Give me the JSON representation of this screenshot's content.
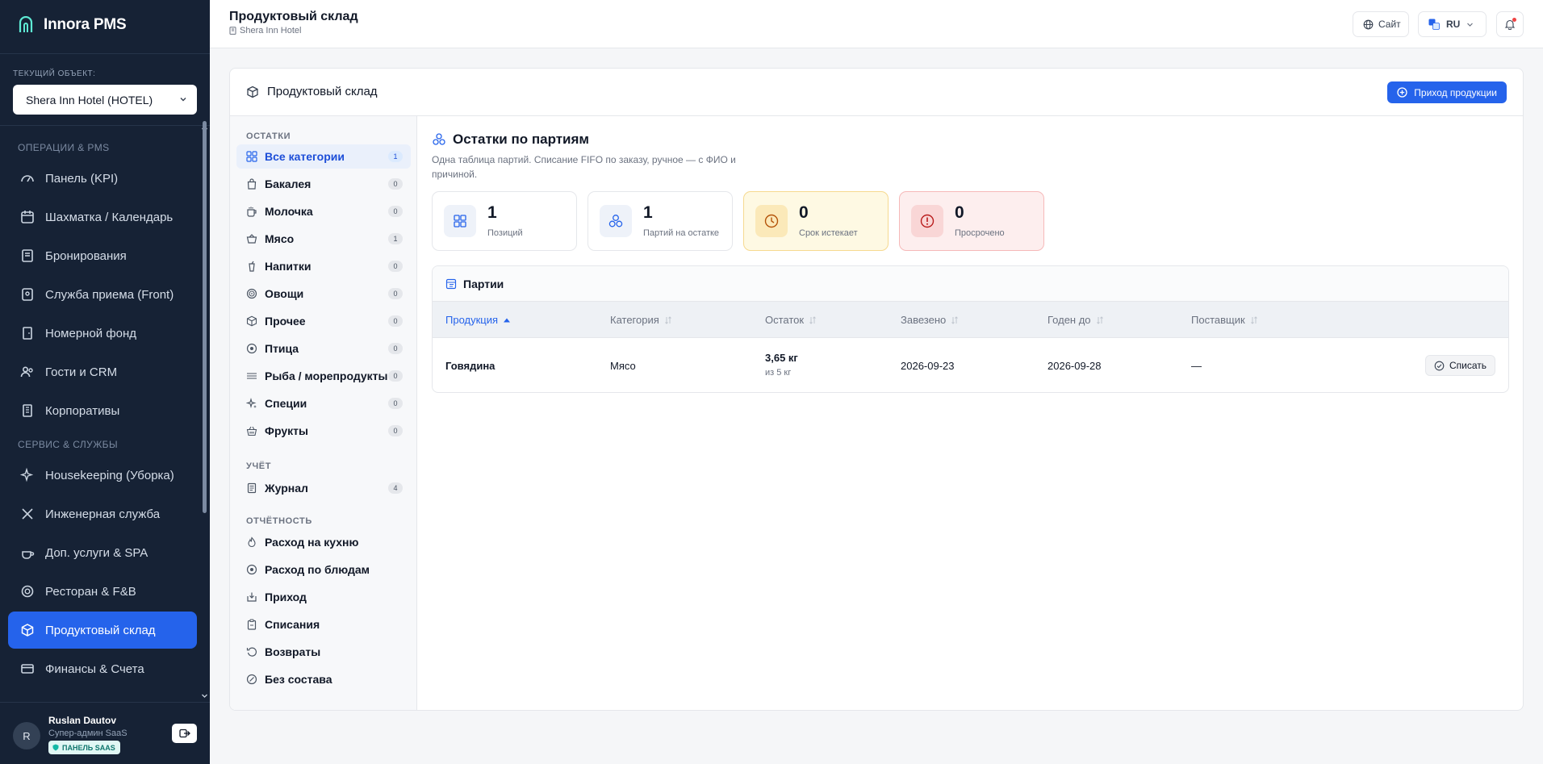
{
  "brand": {
    "name": "Innora PMS"
  },
  "object_selector": {
    "label": "ТЕКУЩИЙ ОБЪЕКТ:",
    "value": "Shera Inn Hotel (HOTEL)"
  },
  "sidebar": {
    "sections": [
      {
        "title": "ОПЕРАЦИИ & PMS"
      },
      {
        "title": "СЕРВИС & СЛУЖБЫ"
      }
    ],
    "items": [
      {
        "label": "Панель (KPI)",
        "icon": "gauge-icon"
      },
      {
        "label": "Шахматка / Календарь",
        "icon": "calendar-icon"
      },
      {
        "label": "Бронирования",
        "icon": "booking-icon"
      },
      {
        "label": "Служба приема (Front)",
        "icon": "reception-icon"
      },
      {
        "label": "Номерной фонд",
        "icon": "door-icon"
      },
      {
        "label": "Гости и CRM",
        "icon": "users-icon"
      },
      {
        "label": "Корпоративы",
        "icon": "building-icon"
      },
      {
        "label": "Housekeeping (Уборка)",
        "icon": "sparkle-icon"
      },
      {
        "label": "Инженерная служба",
        "icon": "tools-icon"
      },
      {
        "label": "Доп. услуги & SPA",
        "icon": "spa-icon"
      },
      {
        "label": "Ресторан & F&B",
        "icon": "dish-icon"
      },
      {
        "label": "Продуктовый склад",
        "icon": "box-icon",
        "active": true
      },
      {
        "label": "Финансы & Счета",
        "icon": "card-icon"
      }
    ]
  },
  "user": {
    "initial": "R",
    "name": "Ruslan Dautov",
    "role": "Супер-админ SaaS",
    "badge": "ПАНЕЛЬ SAAS"
  },
  "header": {
    "title": "Продуктовый склад",
    "subtitle": "Shera Inn Hotel",
    "site_label": "Сайт",
    "lang_label": "RU"
  },
  "card": {
    "title": "Продуктовый склад",
    "primary_button": "Приход продукции"
  },
  "categories": {
    "section_stock": "ОСТАТКИ",
    "items": [
      {
        "label": "Все категории",
        "count": "1",
        "icon": "grid-icon",
        "active": true
      },
      {
        "label": "Бакалея",
        "count": "0",
        "icon": "bag-icon"
      },
      {
        "label": "Молочка",
        "count": "0",
        "icon": "milk-icon"
      },
      {
        "label": "Мясо",
        "count": "1",
        "icon": "meat-icon"
      },
      {
        "label": "Напитки",
        "count": "0",
        "icon": "drink-icon"
      },
      {
        "label": "Овощи",
        "count": "0",
        "icon": "vegetable-icon"
      },
      {
        "label": "Прочее",
        "count": "0",
        "icon": "box-icon"
      },
      {
        "label": "Птица",
        "count": "0",
        "icon": "poultry-icon"
      },
      {
        "label": "Рыба / морепродукты",
        "count": "0",
        "icon": "fish-icon"
      },
      {
        "label": "Специи",
        "count": "0",
        "icon": "spice-icon"
      },
      {
        "label": "Фрукты",
        "count": "0",
        "icon": "basket-icon"
      }
    ],
    "section_accounting": "УЧЁТ",
    "accounting": [
      {
        "label": "Журнал",
        "count": "4",
        "icon": "journal-icon"
      }
    ],
    "section_reports": "ОТЧЁТНОСТЬ",
    "reports": [
      {
        "label": "Расход на кухню",
        "icon": "flame-icon"
      },
      {
        "label": "Расход по блюдам",
        "icon": "dish-icon"
      },
      {
        "label": "Приход",
        "icon": "inbox-icon"
      },
      {
        "label": "Списания",
        "icon": "clipboard-icon"
      },
      {
        "label": "Возвраты",
        "icon": "undo-icon"
      },
      {
        "label": "Без состава",
        "icon": "slash-icon"
      }
    ]
  },
  "batches": {
    "title": "Остатки по партиям",
    "description": "Одна таблица партий. Списание FIFO по заказу, ручное — с ФИО и причиной.",
    "stats": [
      {
        "value": "1",
        "label": "Позиций",
        "icon": "grid-icon",
        "tone": "neutral"
      },
      {
        "value": "1",
        "label": "Партий на остатке",
        "icon": "layers-icon",
        "tone": "neutral"
      },
      {
        "value": "0",
        "label": "Срок истекает",
        "icon": "clock-icon",
        "tone": "warn"
      },
      {
        "value": "0",
        "label": "Просрочено",
        "icon": "alert-icon",
        "tone": "danger"
      }
    ],
    "table": {
      "title": "Партии",
      "columns": [
        "Продукция",
        "Категория",
        "Остаток",
        "Завезено",
        "Годен до",
        "Поставщик"
      ],
      "rows": [
        {
          "product": "Говядина",
          "category": "Мясо",
          "remaining": "3,65 кг",
          "remaining_of": "из 5 кг",
          "received": "2026-09-23",
          "expires": "2026-09-28",
          "supplier": "—",
          "action": "Списать"
        }
      ]
    }
  },
  "colors": {
    "accent": "#2563eb",
    "sidebar_bg": "#162235",
    "warn_bg": "#fef9e3",
    "danger_bg": "#fdeeee"
  }
}
